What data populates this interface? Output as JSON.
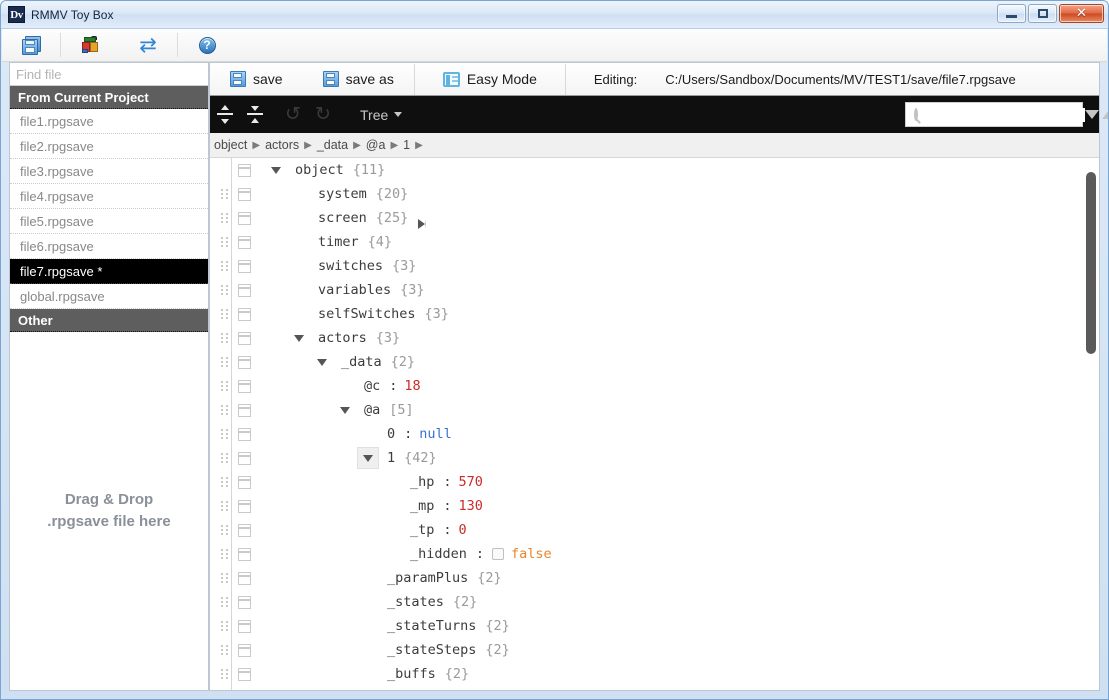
{
  "window": {
    "title": "RMMV Toy Box",
    "app_icon": "Dv",
    "buttons": {
      "minimize": "minimize-icon",
      "maximize": "maximize-icon",
      "close": "✕"
    }
  },
  "app_toolbar": {
    "items": [
      {
        "name": "save-all-icon",
        "icon": "floppy"
      },
      {
        "name": "project-icon",
        "icon": "cube"
      },
      {
        "name": "reload-icon",
        "icon": "refresh"
      },
      {
        "name": "help-icon",
        "icon": "question",
        "glyph": "?"
      }
    ]
  },
  "sidebar": {
    "search": {
      "placeholder": "Find file",
      "value": ""
    },
    "groups": [
      {
        "header": "From Current Project",
        "files": [
          {
            "label": "file1.rpgsave",
            "selected": false
          },
          {
            "label": "file2.rpgsave",
            "selected": false
          },
          {
            "label": "file3.rpgsave",
            "selected": false
          },
          {
            "label": "file4.rpgsave",
            "selected": false
          },
          {
            "label": "file5.rpgsave",
            "selected": false
          },
          {
            "label": "file6.rpgsave",
            "selected": false
          },
          {
            "label": "file7.rpgsave *",
            "selected": true
          },
          {
            "label": "global.rpgsave",
            "selected": false
          }
        ]
      },
      {
        "header": "Other",
        "files": []
      }
    ],
    "dropzone": {
      "line1": "Drag & Drop",
      "line2": ".rpgsave file here"
    }
  },
  "savebar": {
    "save_label": "save",
    "save_as_label": "save as",
    "easy_mode_label": "Easy Mode",
    "editing_label": "Editing:",
    "editing_path": "C:/Users/Sandbox/Documents/MV/TEST1/save/file7.rpgsave"
  },
  "darkbar": {
    "expand_all": "expand-all-icon",
    "collapse_all": "collapse-all-icon",
    "undo": "undo-icon",
    "redo": "redo-icon",
    "mode_label": "Tree",
    "search": {
      "placeholder": "",
      "value": ""
    }
  },
  "breadcrumb": {
    "separator": "▶",
    "items": [
      "object",
      "actors",
      "_data",
      "@a",
      "1"
    ]
  },
  "tree": {
    "rows": [
      {
        "indent": 0,
        "grip": false,
        "tri": "down",
        "key": "object",
        "count": "{11}"
      },
      {
        "indent": 1,
        "grip": true,
        "tri": "right",
        "key": "system",
        "count": "{20}"
      },
      {
        "indent": 1,
        "grip": true,
        "tri": "right",
        "key": "screen",
        "count": "{25}"
      },
      {
        "indent": 1,
        "grip": true,
        "tri": "right",
        "key": "timer",
        "count": "{4}"
      },
      {
        "indent": 1,
        "grip": true,
        "tri": "right",
        "key": "switches",
        "count": "{3}"
      },
      {
        "indent": 1,
        "grip": true,
        "tri": "right",
        "key": "variables",
        "count": "{3}"
      },
      {
        "indent": 1,
        "grip": true,
        "tri": "right",
        "key": "selfSwitches",
        "count": "{3}"
      },
      {
        "indent": 1,
        "grip": true,
        "tri": "down",
        "key": "actors",
        "count": "{3}"
      },
      {
        "indent": 2,
        "grip": true,
        "tri": "down",
        "key": "_data",
        "count": "{2}"
      },
      {
        "indent": 3,
        "grip": true,
        "tri": "none",
        "key": "@c",
        "colon": ":",
        "value": "18",
        "vtype": "num"
      },
      {
        "indent": 3,
        "grip": true,
        "tri": "down",
        "key": "@a",
        "count": "[5]"
      },
      {
        "indent": 4,
        "grip": true,
        "tri": "none",
        "key": "0",
        "colon": ":",
        "value": "null",
        "vtype": "null"
      },
      {
        "indent": 4,
        "grip": true,
        "tri": "down",
        "key": "1",
        "count": "{42}",
        "tri_active": true
      },
      {
        "indent": 5,
        "grip": true,
        "tri": "none",
        "key": "_hp",
        "colon": ":",
        "value": "570",
        "vtype": "num"
      },
      {
        "indent": 5,
        "grip": true,
        "tri": "none",
        "key": "_mp",
        "colon": ":",
        "value": "130",
        "vtype": "num"
      },
      {
        "indent": 5,
        "grip": true,
        "tri": "none",
        "key": "_tp",
        "colon": ":",
        "value": "0",
        "vtype": "num"
      },
      {
        "indent": 5,
        "grip": true,
        "tri": "none",
        "key": "_hidden",
        "colon": ":",
        "value": "false",
        "vtype": "bool",
        "checkbox": true
      },
      {
        "indent": 4,
        "grip": true,
        "tri": "right",
        "key": "_paramPlus",
        "count": "{2}"
      },
      {
        "indent": 4,
        "grip": true,
        "tri": "right",
        "key": "_states",
        "count": "{2}"
      },
      {
        "indent": 4,
        "grip": true,
        "tri": "right",
        "key": "_stateTurns",
        "count": "{2}"
      },
      {
        "indent": 4,
        "grip": true,
        "tri": "right",
        "key": "_stateSteps",
        "count": "{2}"
      },
      {
        "indent": 4,
        "grip": true,
        "tri": "right",
        "key": "_buffs",
        "count": "{2}"
      }
    ]
  },
  "colors": {
    "accent": "#2f86d6",
    "number": "#cc2a2a",
    "null": "#3a6fd8",
    "boolean": "#e8852a",
    "selected_bg": "#000000",
    "group_header_bg": "#5e5e5e",
    "dark_toolbar": "#0f0f0f"
  }
}
